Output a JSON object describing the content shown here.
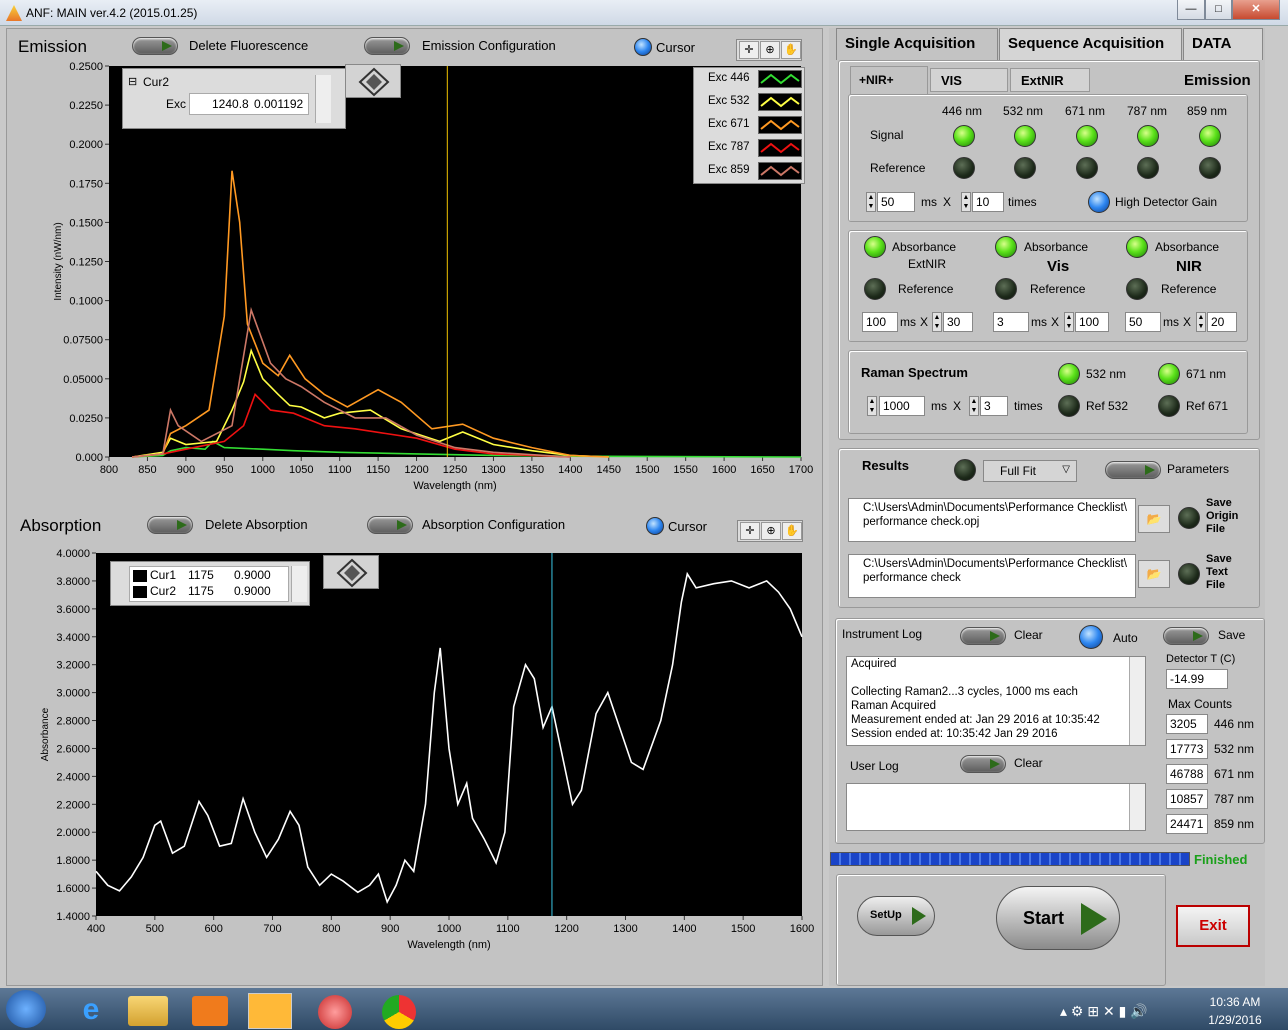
{
  "window": {
    "title": "ANF: MAIN ver.4.2 (2015.01.25)",
    "minimize": "—",
    "maximize": "□",
    "close": "✕"
  },
  "emission": {
    "label": "Emission",
    "delete_label": "Delete Fluorescence",
    "config_label": "Emission Configuration",
    "cursor_label": "Cursor",
    "cursor_table": {
      "name": "Cur2",
      "sub": "Exc",
      "x": "1240.8",
      "y": "0.001192"
    },
    "legend": [
      {
        "name": "Exc 446",
        "color": "#33dd33"
      },
      {
        "name": "Exc 532",
        "color": "#ffff44"
      },
      {
        "name": "Exc 671",
        "color": "#ff9922"
      },
      {
        "name": "Exc 787",
        "color": "#ee1111"
      },
      {
        "name": "Exc 859",
        "color": "#cc7766"
      }
    ]
  },
  "absorption": {
    "label": "Absorption",
    "delete_label": "Delete Absorption",
    "config_label": "Absorption Configuration",
    "cursor_label": "Cursor",
    "cursor_table": [
      {
        "name": "Cur1",
        "x": "1175",
        "y": "0.9000"
      },
      {
        "name": "Cur2",
        "x": "1175",
        "y": "0.9000"
      }
    ]
  },
  "chart_data": [
    {
      "type": "line",
      "title": "",
      "xlabel": "Wavelength (nm)",
      "ylabel": "Intensity (nW/nm)",
      "xlim": [
        800,
        1700
      ],
      "ylim": [
        0,
        0.25
      ],
      "xticks": [
        "800",
        "850",
        "900",
        "950",
        "1000",
        "1050",
        "1100",
        "1150",
        "1200",
        "1250",
        "1300",
        "1350",
        "1400",
        "1450",
        "1500",
        "1550",
        "1600",
        "1650",
        "1700"
      ],
      "yticks": [
        "0.000",
        "0.0250",
        "0.05000",
        "0.07500",
        "0.1000",
        "0.1250",
        "0.1500",
        "0.1750",
        "0.2000",
        "0.2250",
        "0.2500"
      ],
      "cursor_x": 1240,
      "series": [
        {
          "name": "Exc 446",
          "color": "#33dd33",
          "points": [
            [
              830,
              0
            ],
            [
              870,
              0.001
            ],
            [
              880,
              0.004
            ],
            [
              900,
              0.006
            ],
            [
              925,
              0.005
            ],
            [
              935,
              0.01
            ],
            [
              950,
              0.006
            ],
            [
              1000,
              0.005
            ],
            [
              1040,
              0.004
            ],
            [
              1100,
              0.003
            ],
            [
              1200,
              0.002
            ],
            [
              1300,
              0.001
            ],
            [
              1400,
              0.0005
            ],
            [
              1700,
              0
            ]
          ]
        },
        {
          "name": "Exc 532",
          "color": "#ffff44",
          "points": [
            [
              830,
              0
            ],
            [
              870,
              0.003
            ],
            [
              880,
              0.012
            ],
            [
              900,
              0.008
            ],
            [
              940,
              0.01
            ],
            [
              960,
              0.03
            ],
            [
              975,
              0.048
            ],
            [
              985,
              0.068
            ],
            [
              1000,
              0.05
            ],
            [
              1020,
              0.04
            ],
            [
              1035,
              0.033
            ],
            [
              1050,
              0.032
            ],
            [
              1080,
              0.025
            ],
            [
              1100,
              0.028
            ],
            [
              1140,
              0.03
            ],
            [
              1180,
              0.018
            ],
            [
              1230,
              0.01
            ],
            [
              1260,
              0.016
            ],
            [
              1300,
              0.008
            ],
            [
              1350,
              0.004
            ],
            [
              1400,
              0.001
            ],
            [
              1450,
              0
            ]
          ]
        },
        {
          "name": "Exc 671",
          "color": "#ff9922",
          "points": [
            [
              830,
              0
            ],
            [
              870,
              0.002
            ],
            [
              880,
              0.015
            ],
            [
              900,
              0.02
            ],
            [
              930,
              0.03
            ],
            [
              950,
              0.09
            ],
            [
              960,
              0.183
            ],
            [
              970,
              0.15
            ],
            [
              980,
              0.085
            ],
            [
              1000,
              0.06
            ],
            [
              1020,
              0.052
            ],
            [
              1035,
              0.065
            ],
            [
              1055,
              0.05
            ],
            [
              1080,
              0.04
            ],
            [
              1110,
              0.032
            ],
            [
              1150,
              0.043
            ],
            [
              1180,
              0.035
            ],
            [
              1220,
              0.018
            ],
            [
              1260,
              0.021
            ],
            [
              1300,
              0.012
            ],
            [
              1350,
              0.006
            ],
            [
              1400,
              0.001
            ],
            [
              1450,
              0
            ]
          ]
        },
        {
          "name": "Exc 787",
          "color": "#ee1111",
          "points": [
            [
              830,
              0
            ],
            [
              870,
              0.002
            ],
            [
              900,
              0.005
            ],
            [
              950,
              0.01
            ],
            [
              975,
              0.02
            ],
            [
              990,
              0.04
            ],
            [
              1010,
              0.03
            ],
            [
              1040,
              0.028
            ],
            [
              1080,
              0.02
            ],
            [
              1120,
              0.018
            ],
            [
              1160,
              0.015
            ],
            [
              1200,
              0.012
            ],
            [
              1250,
              0.005
            ],
            [
              1300,
              0.002
            ],
            [
              1400,
              0
            ]
          ]
        },
        {
          "name": "Exc 859",
          "color": "#cc7766",
          "points": [
            [
              830,
              0
            ],
            [
              870,
              0.002
            ],
            [
              880,
              0.03
            ],
            [
              890,
              0.02
            ],
            [
              920,
              0.01
            ],
            [
              960,
              0.02
            ],
            [
              985,
              0.094
            ],
            [
              1010,
              0.06
            ],
            [
              1030,
              0.05
            ],
            [
              1050,
              0.045
            ],
            [
              1080,
              0.035
            ],
            [
              1120,
              0.025
            ],
            [
              1160,
              0.025
            ],
            [
              1200,
              0.014
            ],
            [
              1250,
              0.006
            ],
            [
              1300,
              0.003
            ],
            [
              1400,
              0
            ]
          ]
        }
      ]
    },
    {
      "type": "line",
      "title": "",
      "xlabel": "Wavelength (nm)",
      "ylabel": "Absorbance",
      "xlim": [
        400,
        1600
      ],
      "ylim": [
        1.4,
        4.0
      ],
      "xticks": [
        "400",
        "500",
        "600",
        "700",
        "800",
        "900",
        "1000",
        "1100",
        "1200",
        "1300",
        "1400",
        "1500",
        "1600"
      ],
      "yticks": [
        "1.4000",
        "1.6000",
        "1.8000",
        "2.0000",
        "2.2000",
        "2.4000",
        "2.6000",
        "2.8000",
        "3.0000",
        "3.2000",
        "3.4000",
        "3.6000",
        "3.8000",
        "4.0000"
      ],
      "cursor_x": 1175,
      "series": [
        {
          "name": "",
          "color": "#ffffff",
          "points": [
            [
              400,
              1.72
            ],
            [
              420,
              1.62
            ],
            [
              440,
              1.58
            ],
            [
              460,
              1.68
            ],
            [
              480,
              1.82
            ],
            [
              500,
              2.05
            ],
            [
              510,
              2.08
            ],
            [
              530,
              1.85
            ],
            [
              550,
              1.9
            ],
            [
              575,
              2.22
            ],
            [
              590,
              2.12
            ],
            [
              610,
              1.9
            ],
            [
              630,
              1.92
            ],
            [
              650,
              2.24
            ],
            [
              670,
              2.0
            ],
            [
              690,
              1.82
            ],
            [
              710,
              1.95
            ],
            [
              730,
              2.15
            ],
            [
              745,
              2.05
            ],
            [
              760,
              1.75
            ],
            [
              780,
              1.62
            ],
            [
              800,
              1.7
            ],
            [
              820,
              1.65
            ],
            [
              845,
              1.57
            ],
            [
              865,
              1.62
            ],
            [
              880,
              1.7
            ],
            [
              895,
              1.5
            ],
            [
              910,
              1.62
            ],
            [
              925,
              1.8
            ],
            [
              940,
              1.72
            ],
            [
              960,
              2.2
            ],
            [
              975,
              3.0
            ],
            [
              985,
              3.32
            ],
            [
              1000,
              2.6
            ],
            [
              1015,
              2.2
            ],
            [
              1030,
              2.35
            ],
            [
              1040,
              2.1
            ],
            [
              1060,
              1.95
            ],
            [
              1080,
              1.78
            ],
            [
              1095,
              2.0
            ],
            [
              1110,
              2.9
            ],
            [
              1130,
              3.2
            ],
            [
              1145,
              3.1
            ],
            [
              1160,
              2.75
            ],
            [
              1175,
              2.9
            ],
            [
              1190,
              2.6
            ],
            [
              1210,
              2.2
            ],
            [
              1225,
              2.3
            ],
            [
              1250,
              2.85
            ],
            [
              1270,
              3.0
            ],
            [
              1290,
              2.75
            ],
            [
              1310,
              2.5
            ],
            [
              1330,
              2.45
            ],
            [
              1360,
              2.8
            ],
            [
              1380,
              3.2
            ],
            [
              1395,
              3.65
            ],
            [
              1405,
              3.85
            ],
            [
              1420,
              3.75
            ],
            [
              1450,
              3.78
            ],
            [
              1480,
              3.8
            ],
            [
              1510,
              3.75
            ],
            [
              1540,
              3.8
            ],
            [
              1560,
              3.72
            ],
            [
              1580,
              3.6
            ],
            [
              1600,
              3.4
            ]
          ]
        }
      ]
    }
  ],
  "tabs": [
    "Single Acquisition",
    "Sequence Acquisition",
    "DATA"
  ],
  "subtabs": [
    "+NIR+",
    "VIS",
    "ExtNIR"
  ],
  "emission_header": "Emission",
  "wavelengths": [
    "446 nm",
    "532 nm",
    "671 nm",
    "787 nm",
    "859 nm"
  ],
  "signal_label": "Signal",
  "reference_label": "Reference",
  "emission_ms": "50",
  "emission_times": "10",
  "ms_label": "ms",
  "x_label": "X",
  "times_label": "times",
  "high_gain_label": "High Detector Gain",
  "absorbance": [
    {
      "title": "Absorbance",
      "sub": "ExtNIR",
      "ref": "Reference",
      "ms": "100",
      "x": "30"
    },
    {
      "title": "Absorbance",
      "sub": "Vis",
      "ref": "Reference",
      "ms": "3",
      "x": "100"
    },
    {
      "title": "Absorbance",
      "sub": "NIR",
      "ref": "Reference",
      "ms": "50",
      "x": "20"
    }
  ],
  "raman": {
    "label": "Raman Spectrum",
    "ms": "1000",
    "times": "3",
    "l532": "532 nm",
    "l671": "671 nm",
    "r532": "Ref 532",
    "r671": "Ref 671"
  },
  "results": {
    "label": "Results",
    "fit": "Full Fit",
    "params": "Parameters",
    "path1_line1": "C:\\Users\\Admin\\Documents\\Performance Checklist\\",
    "path1_line2": "performance check.opj",
    "save1": "Save Origin File",
    "path2_line1": "C:\\Users\\Admin\\Documents\\Performance Checklist\\",
    "path2_line2": "performance check",
    "save2": "Save Text File"
  },
  "log": {
    "label": "Instrument Log",
    "clear": "Clear",
    "auto": "Auto",
    "save": "Save",
    "lines": [
      "Acquired",
      "",
      "Collecting Raman2...3 cycles, 1000 ms each",
      "Raman Acquired",
      "Measurement ended at: Jan 29 2016 at 10:35:42",
      "Session ended at: 10:35:42  Jan 29 2016"
    ],
    "user_label": "User Log",
    "user_clear": "Clear"
  },
  "detector": {
    "label": "Detector T (C)",
    "value": "-14.99",
    "max_label": "Max Counts",
    "counts": [
      {
        "v": "3205",
        "w": "446 nm"
      },
      {
        "v": "17773",
        "w": "532 nm"
      },
      {
        "v": "46788",
        "w": "671 nm"
      },
      {
        "v": "10857",
        "w": "787 nm"
      },
      {
        "v": "24471",
        "w": "859 nm"
      }
    ]
  },
  "progress": {
    "value": 1.0,
    "status": "Finished"
  },
  "buttons": {
    "setup": "SetUp",
    "start": "Start",
    "exit": "Exit"
  },
  "taskbar": {
    "time": "10:36 AM",
    "date": "1/29/2016"
  }
}
